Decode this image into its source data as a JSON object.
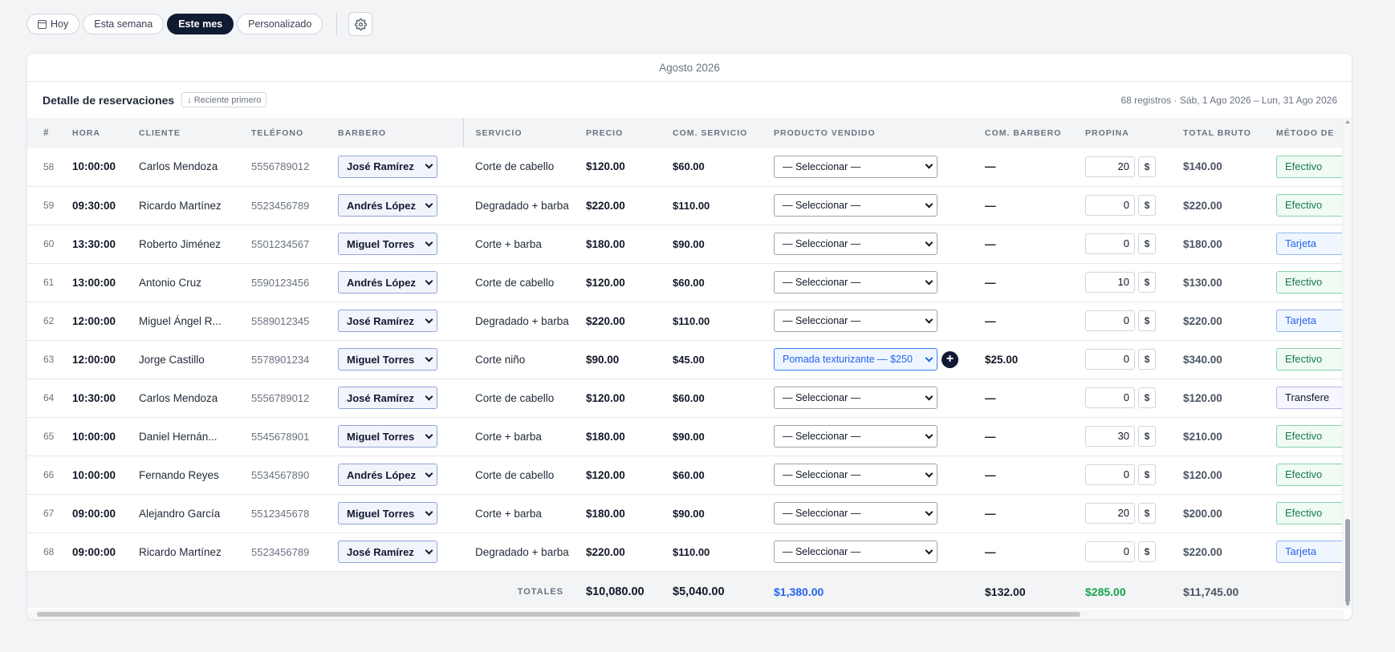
{
  "filters": {
    "today": "Hoy",
    "week": "Esta semana",
    "month": "Este mes",
    "custom": "Personalizado",
    "active": "month"
  },
  "card": {
    "month_title": "Agosto 2026",
    "title": "Detalle de reservaciones",
    "sort_label": "Reciente primero",
    "records_summary": "68 registros · Sáb, 1 Ago 2026 – Lun, 31 Ago 2026"
  },
  "columns": [
    "#",
    "HORA",
    "CLIENTE",
    "TELÉFONO",
    "BARBERO",
    "SERVICIO",
    "PRECIO",
    "COM. SERVICIO",
    "PRODUCTO VENDIDO",
    "COM. BARBERO",
    "PROPINA",
    "TOTAL BRUTO",
    "MÉTODO DE"
  ],
  "rows": [
    {
      "num": "58",
      "hora": "10:00:00",
      "cliente": "Carlos Mendoza",
      "tel": "5556789012",
      "barbero": "José Ramírez",
      "servicio": "Corte de cabello",
      "precio": "$120.00",
      "com_servicio": "$60.00",
      "producto": "— Seleccionar —",
      "producto_sel": false,
      "com_barbero": "—",
      "propina": "20",
      "total": "$140.00",
      "metodo": "Efectivo",
      "metodo_tipo": "green"
    },
    {
      "num": "59",
      "hora": "09:30:00",
      "cliente": "Ricardo Martínez",
      "tel": "5523456789",
      "barbero": "Andrés López",
      "servicio": "Degradado + barba",
      "precio": "$220.00",
      "com_servicio": "$110.00",
      "producto": "— Seleccionar —",
      "producto_sel": false,
      "com_barbero": "—",
      "propina": "0",
      "total": "$220.00",
      "metodo": "Efectivo",
      "metodo_tipo": "green"
    },
    {
      "num": "60",
      "hora": "13:30:00",
      "cliente": "Roberto Jiménez",
      "tel": "5501234567",
      "barbero": "Miguel Torres",
      "servicio": "Corte + barba",
      "precio": "$180.00",
      "com_servicio": "$90.00",
      "producto": "— Seleccionar —",
      "producto_sel": false,
      "com_barbero": "—",
      "propina": "0",
      "total": "$180.00",
      "metodo": "Tarjeta",
      "metodo_tipo": "blue"
    },
    {
      "num": "61",
      "hora": "13:00:00",
      "cliente": "Antonio Cruz",
      "tel": "5590123456",
      "barbero": "Andrés López",
      "servicio": "Corte de cabello",
      "precio": "$120.00",
      "com_servicio": "$60.00",
      "producto": "— Seleccionar —",
      "producto_sel": false,
      "com_barbero": "—",
      "propina": "10",
      "total": "$130.00",
      "metodo": "Efectivo",
      "metodo_tipo": "green"
    },
    {
      "num": "62",
      "hora": "12:00:00",
      "cliente": "Miguel Ángel R...",
      "tel": "5589012345",
      "barbero": "José Ramírez",
      "servicio": "Degradado + barba",
      "precio": "$220.00",
      "com_servicio": "$110.00",
      "producto": "— Seleccionar —",
      "producto_sel": false,
      "com_barbero": "—",
      "propina": "0",
      "total": "$220.00",
      "metodo": "Tarjeta",
      "metodo_tipo": "blue"
    },
    {
      "num": "63",
      "hora": "12:00:00",
      "cliente": "Jorge Castillo",
      "tel": "5578901234",
      "barbero": "Miguel Torres",
      "servicio": "Corte niño",
      "precio": "$90.00",
      "com_servicio": "$45.00",
      "producto": "Pomada texturizante — $250",
      "producto_sel": true,
      "com_barbero": "$25.00",
      "propina": "0",
      "total": "$340.00",
      "metodo": "Efectivo",
      "metodo_tipo": "green"
    },
    {
      "num": "64",
      "hora": "10:30:00",
      "cliente": "Carlos Mendoza",
      "tel": "5556789012",
      "barbero": "José Ramírez",
      "servicio": "Corte de cabello",
      "precio": "$120.00",
      "com_servicio": "$60.00",
      "producto": "— Seleccionar —",
      "producto_sel": false,
      "com_barbero": "—",
      "propina": "0",
      "total": "$120.00",
      "metodo": "Transfere",
      "metodo_tipo": "purple"
    },
    {
      "num": "65",
      "hora": "10:00:00",
      "cliente": "Daniel Hernán...",
      "tel": "5545678901",
      "barbero": "Miguel Torres",
      "servicio": "Corte + barba",
      "precio": "$180.00",
      "com_servicio": "$90.00",
      "producto": "— Seleccionar —",
      "producto_sel": false,
      "com_barbero": "—",
      "propina": "30",
      "total": "$210.00",
      "metodo": "Efectivo",
      "metodo_tipo": "green"
    },
    {
      "num": "66",
      "hora": "10:00:00",
      "cliente": "Fernando Reyes",
      "tel": "5534567890",
      "barbero": "Andrés López",
      "servicio": "Corte de cabello",
      "precio": "$120.00",
      "com_servicio": "$60.00",
      "producto": "— Seleccionar —",
      "producto_sel": false,
      "com_barbero": "—",
      "propina": "0",
      "total": "$120.00",
      "metodo": "Efectivo",
      "metodo_tipo": "green"
    },
    {
      "num": "67",
      "hora": "09:00:00",
      "cliente": "Alejandro García",
      "tel": "5512345678",
      "barbero": "Miguel Torres",
      "servicio": "Corte + barba",
      "precio": "$180.00",
      "com_servicio": "$90.00",
      "producto": "— Seleccionar —",
      "producto_sel": false,
      "com_barbero": "—",
      "propina": "20",
      "total": "$200.00",
      "metodo": "Efectivo",
      "metodo_tipo": "green"
    },
    {
      "num": "68",
      "hora": "09:00:00",
      "cliente": "Ricardo Martínez",
      "tel": "5523456789",
      "barbero": "José Ramírez",
      "servicio": "Degradado + barba",
      "precio": "$220.00",
      "com_servicio": "$110.00",
      "producto": "— Seleccionar —",
      "producto_sel": false,
      "com_barbero": "—",
      "propina": "0",
      "total": "$220.00",
      "metodo": "Tarjeta",
      "metodo_tipo": "blue"
    }
  ],
  "tip_currency": "$",
  "totals": {
    "label": "TOTALES",
    "precio": "$10,080.00",
    "com_servicio": "$5,040.00",
    "producto": "$1,380.00",
    "com_barbero": "$132.00",
    "propina": "$285.00",
    "total": "$11,745.00"
  },
  "colors": {
    "accent": "#111a33",
    "green": "#16794c",
    "blue": "#2563eb"
  }
}
